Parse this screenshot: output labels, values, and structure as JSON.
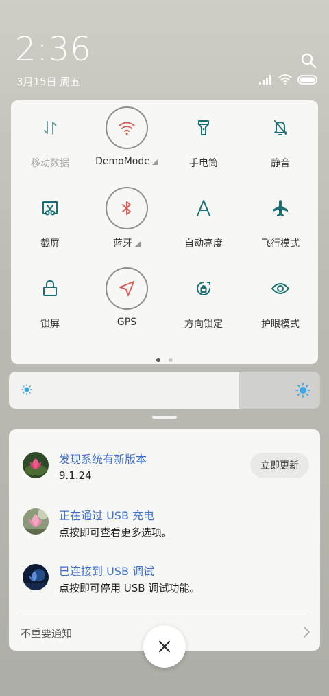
{
  "status": {
    "time": "2:36",
    "date": "3月15日 周五",
    "battery_level": 1.0
  },
  "quick_settings": {
    "tiles": [
      {
        "label": "移动数据",
        "icon": "mobile-data-icon",
        "active": false,
        "dim": true
      },
      {
        "label": "DemoMode",
        "icon": "wifi-icon",
        "active": true,
        "expand": true
      },
      {
        "label": "手电筒",
        "icon": "flashlight-icon",
        "active": false
      },
      {
        "label": "静音",
        "icon": "bell-off-icon",
        "active": false
      },
      {
        "label": "截屏",
        "icon": "screenshot-icon",
        "active": false
      },
      {
        "label": "蓝牙",
        "icon": "bluetooth-icon",
        "active": true,
        "expand": true
      },
      {
        "label": "自动亮度",
        "icon": "auto-brightness-icon",
        "active": false
      },
      {
        "label": "飞行模式",
        "icon": "airplane-icon",
        "active": false
      },
      {
        "label": "锁屏",
        "icon": "lock-icon",
        "active": false
      },
      {
        "label": "GPS",
        "icon": "gps-icon",
        "active": true
      },
      {
        "label": "方向锁定",
        "icon": "rotation-lock-icon",
        "active": false
      },
      {
        "label": "护眼模式",
        "icon": "eye-icon",
        "active": false
      }
    ],
    "page_count": 2,
    "current_page": 1
  },
  "brightness": {
    "level": 0.74
  },
  "notifications": [
    {
      "title": "发现系统有新版本",
      "text": "9.1.24",
      "button": "立即更新"
    },
    {
      "title": "正在通过  USB  充电",
      "text": "点按即可查看更多选项。"
    },
    {
      "title": "已连接到  USB  调试",
      "text": "点按即可停用 USB 调试功能。"
    }
  ],
  "unimportant_label": "不重要通知",
  "colors": {
    "accent_teal": "#1a6f74",
    "active_red": "#d9605a",
    "notification_title": "#3d6fd0",
    "brightness_sun": "#3da6e8"
  }
}
